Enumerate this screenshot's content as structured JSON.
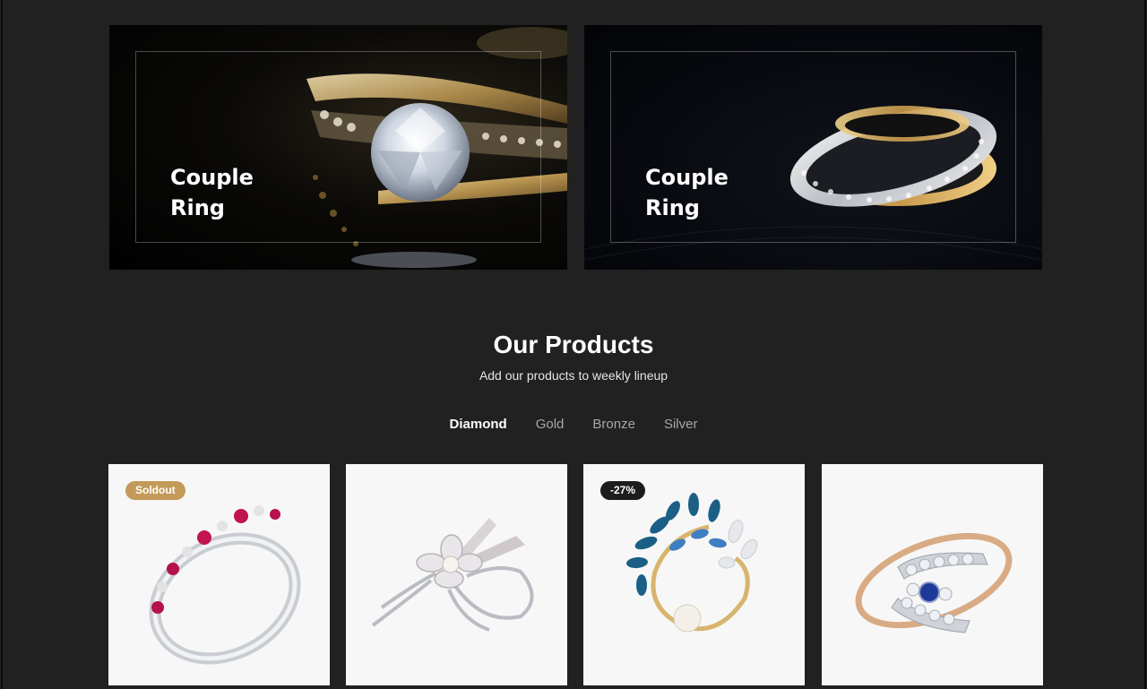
{
  "banners": [
    {
      "title": "Couple\nRing"
    },
    {
      "title": "Couple\nRing"
    }
  ],
  "products_section": {
    "title": "Our Products",
    "subtitle": "Add our products to weekly lineup",
    "tabs": [
      {
        "label": "Diamond",
        "active": true
      },
      {
        "label": "Gold",
        "active": false
      },
      {
        "label": "Bronze",
        "active": false
      },
      {
        "label": "Silver",
        "active": false
      }
    ]
  },
  "products": [
    {
      "image": "ruby-diamond-ring-icon",
      "badge": "Soldout"
    },
    {
      "image": "silver-flower-brooch-icon",
      "badge": ""
    },
    {
      "image": "sapphire-pearl-brooch-icon",
      "badge": "-27%"
    },
    {
      "image": "sapphire-twist-ring-icon",
      "badge": ""
    }
  ],
  "colors": {
    "background": "#212121",
    "badge_soldout": "#c39a59",
    "badge_sale": "#1d1d1d",
    "tab_active": "#ffffff",
    "tab_inactive": "#a7a7a7"
  }
}
